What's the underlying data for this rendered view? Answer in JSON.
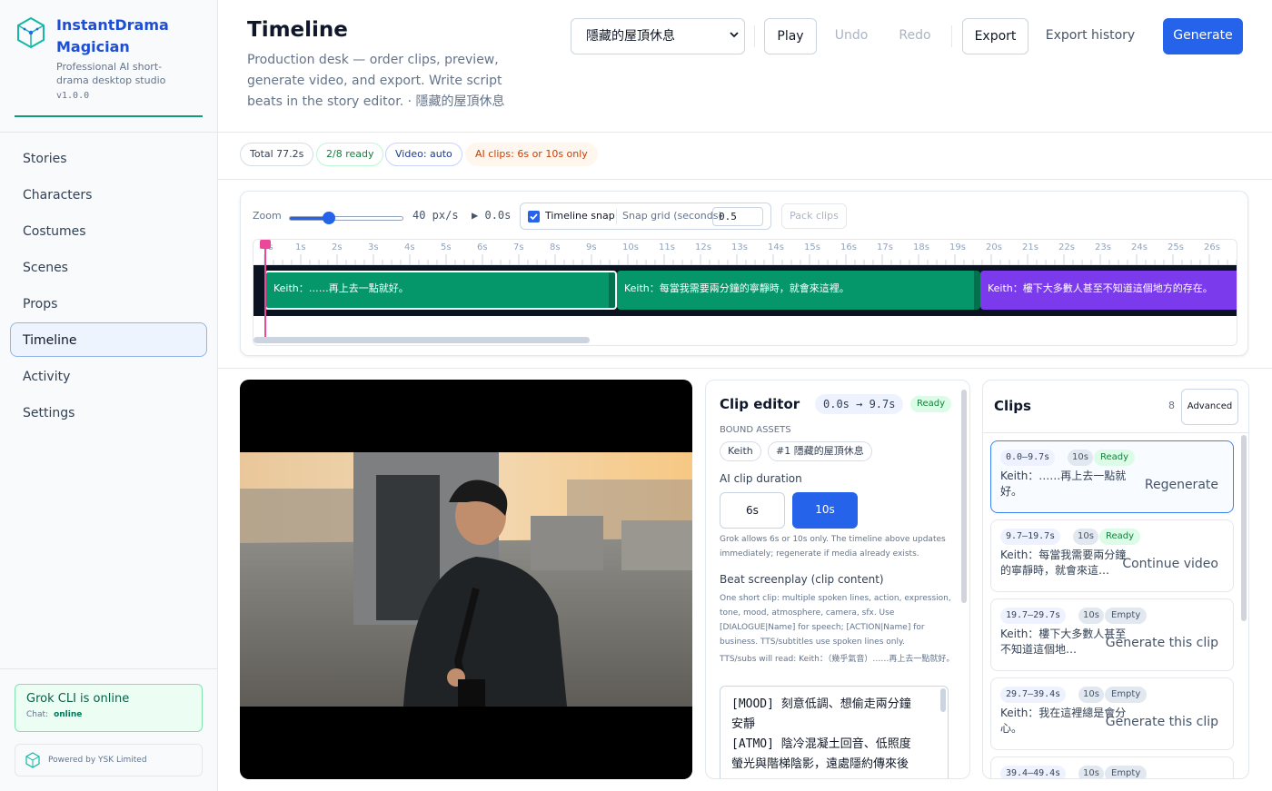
{
  "app": {
    "name": "InstantDrama Magician",
    "subtitle": "Professional AI short-drama desktop studio",
    "version": "v1.0.0",
    "accent": "#2563eb"
  },
  "sidebar": {
    "items": [
      {
        "label": "Stories",
        "active": false
      },
      {
        "label": "Characters",
        "active": false
      },
      {
        "label": "Costumes",
        "active": false
      },
      {
        "label": "Scenes",
        "active": false
      },
      {
        "label": "Props",
        "active": false
      },
      {
        "label": "Timeline",
        "active": true
      },
      {
        "label": "Activity",
        "active": false
      },
      {
        "label": "Settings",
        "active": false
      }
    ],
    "status": {
      "title": "Grok CLI is online",
      "chat_label": "Chat:",
      "chat_value": "online",
      "color": "#059669"
    },
    "powered_by": "Powered by YSK Limited"
  },
  "header": {
    "title": "Timeline",
    "description": "Production desk — order clips, preview, generate video, and export. Write script beats in the story editor. · 隱藏的屋頂休息",
    "story_select": "隱藏的屋頂休息",
    "buttons": {
      "play": "Play",
      "undo": "Undo",
      "redo": "Redo",
      "export": "Export",
      "export_history": "Export history",
      "generate": "Generate"
    }
  },
  "summary_chips": [
    {
      "label": "Total 77.2s",
      "tone": "neutral"
    },
    {
      "label": "2/8 ready",
      "tone": "success"
    },
    {
      "label": "Video: auto",
      "tone": "info"
    },
    {
      "label": "AI clips: 6s or 10s only",
      "tone": "warning"
    }
  ],
  "timeline_toolbar": {
    "zoom_label": "Zoom",
    "zoom_level": 0.35,
    "zoom_readout": "40 px/s",
    "playhead_readout": "▶ 0.0s",
    "snap_label": "Timeline snap",
    "snap_checked": true,
    "grid_label": "Snap grid (seconds)",
    "grid_value": "0.5",
    "pack_label": "Pack clips"
  },
  "ruler_ticks": [
    "0s",
    "1s",
    "2s",
    "3s",
    "4s",
    "5s",
    "6s",
    "7s",
    "8s",
    "9s",
    "10s",
    "11s",
    "12s",
    "13s",
    "14s",
    "15s",
    "16s",
    "17s",
    "18s",
    "19s",
    "20s",
    "21s",
    "22s",
    "23s",
    "24s",
    "25s",
    "26s"
  ],
  "timeline_clips": [
    {
      "text": "Keith：……再上去一點就好。",
      "start": 0.0,
      "end": 9.7,
      "color": "#059669",
      "selected": true
    },
    {
      "text": "Keith：每當我需要兩分鐘的寧靜時，就會來這裡。",
      "start": 9.7,
      "end": 19.7,
      "color": "#059669",
      "selected": false
    },
    {
      "text": "Keith：樓下大多數人甚至不知道這個地方的存在。",
      "start": 19.7,
      "end": 29.7,
      "color": "#7c3aed",
      "selected": false
    }
  ],
  "clip_editor": {
    "title": "Clip editor",
    "range": "0.0s → 9.7s",
    "status": "Ready",
    "bound_assets_label": "BOUND ASSETS",
    "assets": [
      "Keith",
      "#1 隱藏的屋頂休息"
    ],
    "duration_label": "AI clip duration",
    "durations": [
      "6s",
      "10s"
    ],
    "selected_duration": "10s",
    "duration_note": "Grok allows 6s or 10s only. The timeline above updates immediately; regenerate if media already exists.",
    "beat_label": "Beat screenplay (clip content)",
    "beat_note": "One short clip: multiple spoken lines, action, expression, tone, mood, atmosphere, camera, sfx. Use [DIALOGUE|Name] for speech; [ACTION|Name] for business. TTS/subtitles use spoken lines only.",
    "tts_note": "TTS/subs will read: Keith：（幾乎氣音）……再上去一點就好。",
    "script_lines": [
      "[MOOD] 刻意低調、想偷走兩分鐘",
      "安靜",
      "[ATMO] 陰冷混凝土回音、低照度",
      "螢光與階梯陰影，遠處隱約傳來後"
    ]
  },
  "clips_panel": {
    "title": "Clips",
    "count": "8",
    "advanced_label": "Advanced",
    "clips": [
      {
        "range": "0.0–9.7s",
        "duration": "10s",
        "status": "Ready",
        "text": "Keith：……再上去一點就好。",
        "action": "Regenerate",
        "selected": true
      },
      {
        "range": "9.7–19.7s",
        "duration": "10s",
        "status": "Ready",
        "text": "Keith：每當我需要兩分鐘的寧靜時，就會來這…",
        "action": "Continue video",
        "selected": false
      },
      {
        "range": "19.7–29.7s",
        "duration": "10s",
        "status": "Empty",
        "text": "Keith：樓下大多數人甚至不知道這個地…",
        "action": "Generate this clip",
        "selected": false
      },
      {
        "range": "29.7–39.4s",
        "duration": "10s",
        "status": "Empty",
        "text": "Keith：我在這裡總是會分心。",
        "action": "Generate this clip",
        "selected": false
      },
      {
        "range": "39.4–49.4s",
        "duration": "10s",
        "status": "Empty",
        "text": "",
        "action": "",
        "selected": false
      }
    ]
  }
}
